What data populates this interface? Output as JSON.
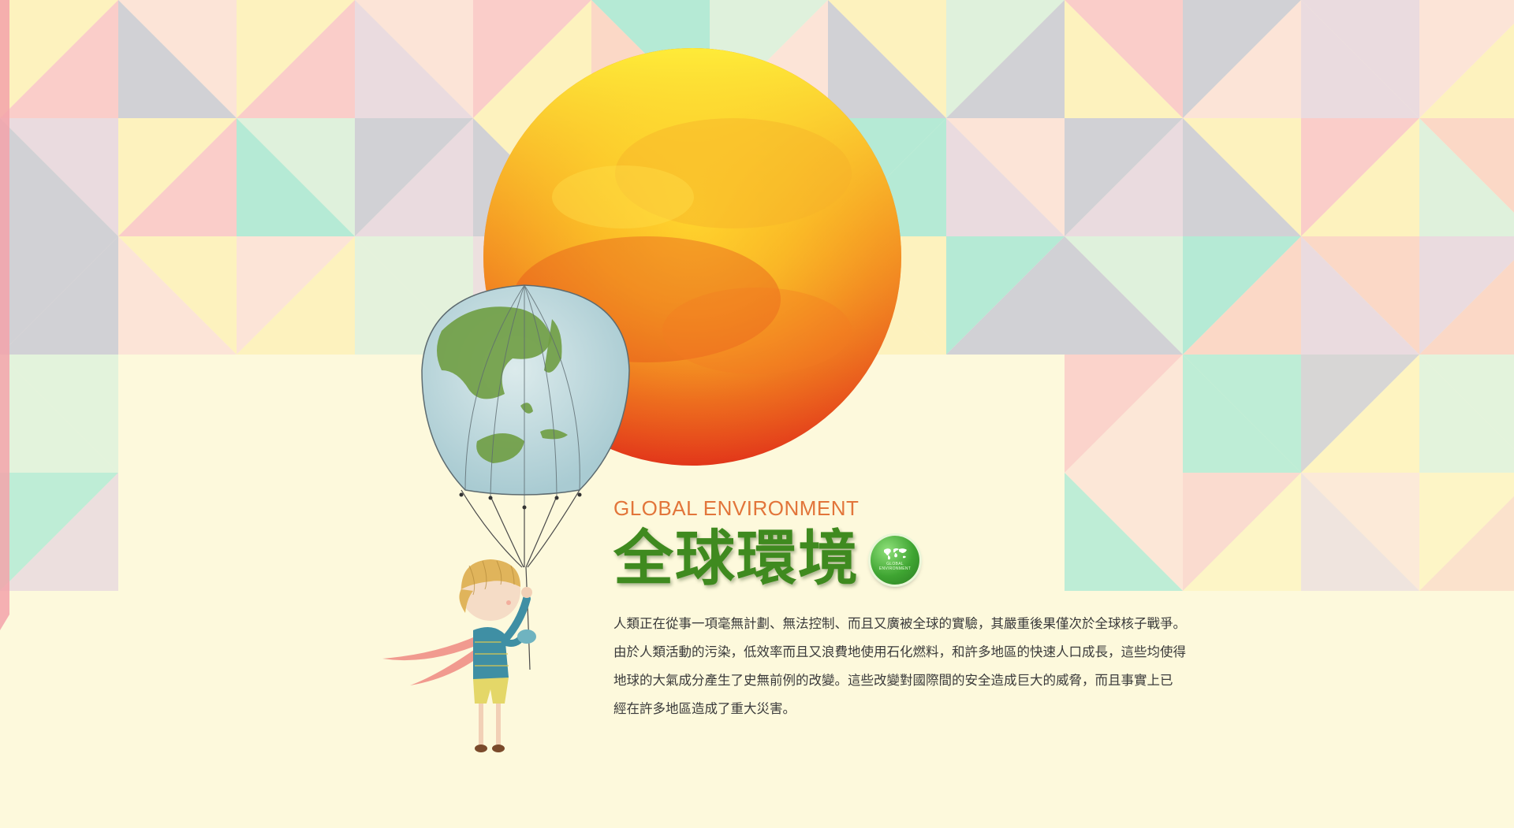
{
  "section": {
    "subtitle": "GLOBAL ENVIRONMENT",
    "title": "全球環境",
    "badge": {
      "icon": "world-map-icon",
      "label_line1": "GLOBAL",
      "label_line2": "ENVIRONMENT"
    },
    "paragraph": "人類正在從事一項毫無計劃、無法控制、而且又廣被全球的實驗，其嚴重後果僅次於全球核子戰爭。\n由於人類活動的污染，低效率而且又浪費地使用石化燃料，和許多地區的快速人口成長，這些均使得\n地球的大氣成分產生了史無前例的改變。這些改變對國際間的安全造成巨大的威脅，而且事實上已\n經在許多地區造成了重大災害。"
  },
  "colors": {
    "background": "#fdf9dc",
    "title_green": "#3f8a1f",
    "subtitle_orange": "#e2753a",
    "sun_outer": "#e8401c",
    "sun_inner": "#ffe22a",
    "globe_ocean": "#b9d6dc",
    "globe_land": "#6f9d43",
    "triangle_palette": [
      "#fbe0d6",
      "#c9cad3",
      "#a8e8d4",
      "#fdf1b8",
      "#f9c6c6",
      "#d9f0dc",
      "#fad2c2",
      "#e6d6df"
    ]
  },
  "illustration": {
    "sun": "sun-watercolor",
    "balloon": "earth-balloon-icon",
    "child": "child-holding-balloon"
  }
}
